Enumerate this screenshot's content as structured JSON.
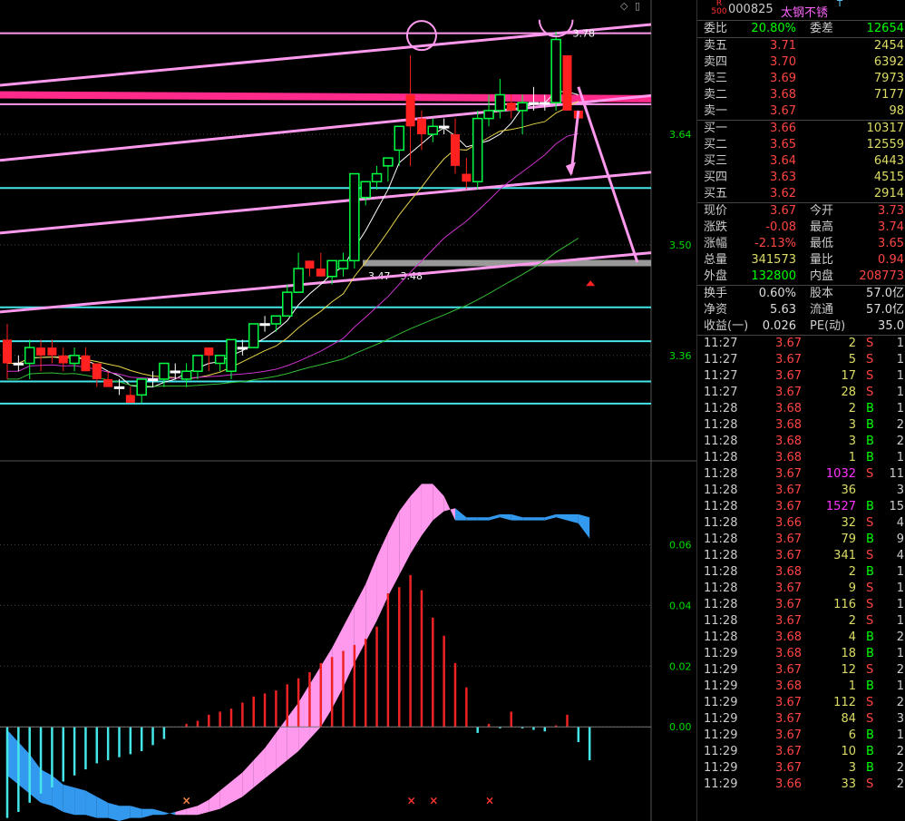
{
  "chart_data": [
    {
      "type": "candlestick",
      "title": "",
      "y_ticks": [
        "3.64",
        "3.50",
        "3.36"
      ],
      "y_tick_values": [
        3.64,
        3.5,
        3.36
      ],
      "ylim": [
        3.23,
        3.81
      ],
      "annotations": {
        "high_label": "3.78",
        "range_label": "3.47 - 3.48"
      },
      "candles": [
        {
          "o": 3.38,
          "h": 3.4,
          "l": 3.33,
          "c": 3.35
        },
        {
          "o": 3.35,
          "h": 3.36,
          "l": 3.34,
          "c": 3.35
        },
        {
          "o": 3.35,
          "h": 3.38,
          "l": 3.33,
          "c": 3.37
        },
        {
          "o": 3.37,
          "h": 3.38,
          "l": 3.34,
          "c": 3.36
        },
        {
          "o": 3.37,
          "h": 3.38,
          "l": 3.35,
          "c": 3.36
        },
        {
          "o": 3.36,
          "h": 3.37,
          "l": 3.34,
          "c": 3.35
        },
        {
          "o": 3.35,
          "h": 3.37,
          "l": 3.34,
          "c": 3.36
        },
        {
          "o": 3.36,
          "h": 3.37,
          "l": 3.34,
          "c": 3.34
        },
        {
          "o": 3.35,
          "h": 3.35,
          "l": 3.32,
          "c": 3.33
        },
        {
          "o": 3.33,
          "h": 3.34,
          "l": 3.32,
          "c": 3.32
        },
        {
          "o": 3.32,
          "h": 3.33,
          "l": 3.31,
          "c": 3.32
        },
        {
          "o": 3.31,
          "h": 3.32,
          "l": 3.3,
          "c": 3.3
        },
        {
          "o": 3.31,
          "h": 3.33,
          "l": 3.3,
          "c": 3.33
        },
        {
          "o": 3.33,
          "h": 3.34,
          "l": 3.32,
          "c": 3.33
        },
        {
          "o": 3.33,
          "h": 3.35,
          "l": 3.32,
          "c": 3.35
        },
        {
          "o": 3.34,
          "h": 3.35,
          "l": 3.33,
          "c": 3.34
        },
        {
          "o": 3.33,
          "h": 3.35,
          "l": 3.32,
          "c": 3.34
        },
        {
          "o": 3.34,
          "h": 3.36,
          "l": 3.33,
          "c": 3.36
        },
        {
          "o": 3.37,
          "h": 3.37,
          "l": 3.34,
          "c": 3.36
        },
        {
          "o": 3.35,
          "h": 3.36,
          "l": 3.34,
          "c": 3.36
        },
        {
          "o": 3.34,
          "h": 3.38,
          "l": 3.33,
          "c": 3.38
        },
        {
          "o": 3.37,
          "h": 3.38,
          "l": 3.36,
          "c": 3.37
        },
        {
          "o": 3.37,
          "h": 3.4,
          "l": 3.37,
          "c": 3.4
        },
        {
          "o": 3.4,
          "h": 3.41,
          "l": 3.39,
          "c": 3.4
        },
        {
          "o": 3.4,
          "h": 3.41,
          "l": 3.39,
          "c": 3.41
        },
        {
          "o": 3.41,
          "h": 3.45,
          "l": 3.41,
          "c": 3.44
        },
        {
          "o": 3.44,
          "h": 3.49,
          "l": 3.44,
          "c": 3.47
        },
        {
          "o": 3.48,
          "h": 3.48,
          "l": 3.46,
          "c": 3.47
        },
        {
          "o": 3.47,
          "h": 3.49,
          "l": 3.46,
          "c": 3.46
        },
        {
          "o": 3.46,
          "h": 3.48,
          "l": 3.45,
          "c": 3.48
        },
        {
          "o": 3.47,
          "h": 3.49,
          "l": 3.46,
          "c": 3.48
        },
        {
          "o": 3.48,
          "h": 3.59,
          "l": 3.47,
          "c": 3.59
        },
        {
          "o": 3.56,
          "h": 3.58,
          "l": 3.55,
          "c": 3.58
        },
        {
          "o": 3.58,
          "h": 3.6,
          "l": 3.57,
          "c": 3.59
        },
        {
          "o": 3.6,
          "h": 3.61,
          "l": 3.58,
          "c": 3.61
        },
        {
          "o": 3.62,
          "h": 3.65,
          "l": 3.6,
          "c": 3.65
        },
        {
          "o": 3.69,
          "h": 3.74,
          "l": 3.6,
          "c": 3.65
        },
        {
          "o": 3.66,
          "h": 3.67,
          "l": 3.62,
          "c": 3.64
        },
        {
          "o": 3.64,
          "h": 3.66,
          "l": 3.63,
          "c": 3.65
        },
        {
          "o": 3.65,
          "h": 3.66,
          "l": 3.64,
          "c": 3.65
        },
        {
          "o": 3.64,
          "h": 3.66,
          "l": 3.59,
          "c": 3.6
        },
        {
          "o": 3.59,
          "h": 3.61,
          "l": 3.57,
          "c": 3.58
        },
        {
          "o": 3.58,
          "h": 3.67,
          "l": 3.57,
          "c": 3.66
        },
        {
          "o": 3.66,
          "h": 3.69,
          "l": 3.65,
          "c": 3.67
        },
        {
          "o": 3.67,
          "h": 3.71,
          "l": 3.66,
          "c": 3.69
        },
        {
          "o": 3.68,
          "h": 3.69,
          "l": 3.66,
          "c": 3.67
        },
        {
          "o": 3.67,
          "h": 3.69,
          "l": 3.64,
          "c": 3.68
        },
        {
          "o": 3.68,
          "h": 3.7,
          "l": 3.67,
          "c": 3.68
        },
        {
          "o": 3.68,
          "h": 3.69,
          "l": 3.67,
          "c": 3.68
        },
        {
          "o": 3.68,
          "h": 3.77,
          "l": 3.67,
          "c": 3.76
        },
        {
          "o": 3.74,
          "h": 3.74,
          "l": 3.67,
          "c": 3.67
        },
        {
          "o": 3.67,
          "h": 3.67,
          "l": 3.66,
          "c": 3.66
        }
      ]
    },
    {
      "type": "bar",
      "title": "",
      "y_ticks": [
        "0.06",
        "0.04",
        "0.02",
        "0.00"
      ],
      "y_tick_values": [
        0.06,
        0.04,
        0.02,
        0.0
      ],
      "ylim": [
        -0.031,
        0.087
      ],
      "values": [
        -0.03,
        -0.028,
        -0.025,
        -0.022,
        -0.02,
        -0.018,
        -0.016,
        -0.014,
        -0.012,
        -0.011,
        -0.01,
        -0.009,
        -0.008,
        -0.006,
        -0.004,
        0.0,
        0.001,
        0.002,
        0.004,
        0.005,
        0.006,
        0.008,
        0.01,
        0.011,
        0.012,
        0.014,
        0.016,
        0.018,
        0.021,
        0.023,
        0.025,
        0.027,
        0.029,
        0.033,
        0.044,
        0.046,
        0.05,
        0.045,
        0.036,
        0.03,
        0.021,
        0.013,
        -0.002,
        0.001,
        -0.0005,
        0.005,
        -0.0005,
        -0.001,
        -0.0015,
        0.0005,
        0.004,
        -0.005,
        -0.011
      ],
      "dif": [
        -0.016,
        -0.019,
        -0.022,
        -0.025,
        -0.026,
        -0.028,
        -0.029,
        -0.029,
        -0.03,
        -0.03,
        -0.031,
        -0.03,
        -0.03,
        -0.029,
        -0.029,
        -0.028,
        -0.027,
        -0.026,
        -0.024,
        -0.021,
        -0.018,
        -0.015,
        -0.011,
        -0.007,
        -0.002,
        0.003,
        0.008,
        0.014,
        0.02,
        0.026,
        0.033,
        0.04,
        0.047,
        0.056,
        0.064,
        0.071,
        0.076,
        0.08,
        0.08,
        0.076,
        0.068,
        0.068,
        0.068,
        0.068,
        0.069,
        0.068,
        0.068,
        0.068,
        0.068,
        0.069,
        0.068,
        0.067,
        0.062
      ],
      "dea": [
        -0.001,
        -0.005,
        -0.009,
        -0.014,
        -0.016,
        -0.019,
        -0.02,
        -0.021,
        -0.023,
        -0.025,
        -0.026,
        -0.026,
        -0.027,
        -0.027,
        -0.028,
        -0.029,
        -0.029,
        -0.029,
        -0.028,
        -0.027,
        -0.025,
        -0.023,
        -0.02,
        -0.017,
        -0.014,
        -0.011,
        -0.008,
        -0.004,
        0.0,
        0.006,
        0.013,
        0.021,
        0.028,
        0.035,
        0.043,
        0.05,
        0.057,
        0.063,
        0.068,
        0.071,
        0.072,
        0.069,
        0.069,
        0.069,
        0.07,
        0.07,
        0.069,
        0.069,
        0.069,
        0.07,
        0.07,
        0.07,
        0.069
      ],
      "x_marks": [
        36,
        38,
        43
      ]
    }
  ],
  "colors": {
    "up": "#ff2222",
    "down": "#00ff66",
    "cyan": "#44e6ea",
    "pink": "#ff99ee",
    "hotpink": "#ff2a8a",
    "blue": "#3399ee"
  },
  "quote": {
    "exchange_badge_top": "R",
    "exchange_badge_bottom": "500",
    "code": "000825",
    "name": "太钢不锈",
    "t_mark": "T",
    "weibi_label": "委比",
    "weibi_value": "20.80%",
    "weicha_label": "委差",
    "weicha_value": "12654",
    "asks": [
      {
        "label": "卖五",
        "price": "3.71",
        "vol": "2454"
      },
      {
        "label": "卖四",
        "price": "3.70",
        "vol": "6392"
      },
      {
        "label": "卖三",
        "price": "3.69",
        "vol": "7973"
      },
      {
        "label": "卖二",
        "price": "3.68",
        "vol": "7177"
      },
      {
        "label": "卖一",
        "price": "3.67",
        "vol": "98"
      }
    ],
    "bids": [
      {
        "label": "买一",
        "price": "3.66",
        "vol": "10317"
      },
      {
        "label": "买二",
        "price": "3.65",
        "vol": "12559"
      },
      {
        "label": "买三",
        "price": "3.64",
        "vol": "6443"
      },
      {
        "label": "买四",
        "price": "3.63",
        "vol": "4515"
      },
      {
        "label": "买五",
        "price": "3.62",
        "vol": "2914"
      }
    ],
    "stats1": [
      {
        "l1": "现价",
        "v1": "3.67",
        "c1": "red",
        "l2": "今开",
        "v2": "3.73",
        "c2": "red"
      },
      {
        "l1": "涨跌",
        "v1": "-0.08",
        "c1": "red",
        "l2": "最高",
        "v2": "3.74",
        "c2": "red"
      },
      {
        "l1": "涨幅",
        "v1": "-2.13%",
        "c1": "red",
        "l2": "最低",
        "v2": "3.65",
        "c2": "red"
      },
      {
        "l1": "总量",
        "v1": "341573",
        "c1": "yel",
        "l2": "量比",
        "v2": "0.94",
        "c2": "red"
      },
      {
        "l1": "外盘",
        "v1": "132800",
        "c1": "green",
        "l2": "内盘",
        "v2": "208773",
        "c2": "red"
      }
    ],
    "stats2": [
      {
        "l1": "换手",
        "v1": "0.60%",
        "l2": "股本",
        "v2": "57.0亿"
      },
      {
        "l1": "净资",
        "v1": "5.63",
        "l2": "流通",
        "v2": "57.0亿"
      },
      {
        "l1": "收益(一)",
        "v1": "0.026",
        "l2": "PE(动)",
        "v2": "35.0"
      }
    ],
    "ticks": [
      {
        "t": "11:27",
        "p": "3.67",
        "v": "2",
        "bs": "S",
        "n": "1",
        "vc": "yel"
      },
      {
        "t": "11:27",
        "p": "3.67",
        "v": "5",
        "bs": "S",
        "n": "1",
        "vc": "yel"
      },
      {
        "t": "11:27",
        "p": "3.67",
        "v": "17",
        "bs": "S",
        "n": "1",
        "vc": "yel"
      },
      {
        "t": "11:27",
        "p": "3.67",
        "v": "28",
        "bs": "S",
        "n": "1",
        "vc": "yel"
      },
      {
        "t": "11:28",
        "p": "3.68",
        "v": "2",
        "bs": "B",
        "n": "1",
        "vc": "yel"
      },
      {
        "t": "11:28",
        "p": "3.68",
        "v": "3",
        "bs": "B",
        "n": "2",
        "vc": "yel"
      },
      {
        "t": "11:28",
        "p": "3.68",
        "v": "3",
        "bs": "B",
        "n": "2",
        "vc": "yel"
      },
      {
        "t": "11:28",
        "p": "3.68",
        "v": "1",
        "bs": "B",
        "n": "1",
        "vc": "yel"
      },
      {
        "t": "11:28",
        "p": "3.67",
        "v": "1032",
        "bs": "S",
        "n": "11",
        "vc": "mag"
      },
      {
        "t": "11:28",
        "p": "3.67",
        "v": "36",
        "bs": "",
        "n": "3",
        "vc": "yel"
      },
      {
        "t": "11:28",
        "p": "3.67",
        "v": "1527",
        "bs": "B",
        "n": "15",
        "vc": "mag"
      },
      {
        "t": "11:28",
        "p": "3.66",
        "v": "32",
        "bs": "S",
        "n": "4",
        "vc": "yel"
      },
      {
        "t": "11:28",
        "p": "3.67",
        "v": "79",
        "bs": "B",
        "n": "9",
        "vc": "yel"
      },
      {
        "t": "11:28",
        "p": "3.67",
        "v": "341",
        "bs": "S",
        "n": "4",
        "vc": "yel"
      },
      {
        "t": "11:28",
        "p": "3.68",
        "v": "2",
        "bs": "B",
        "n": "1",
        "vc": "yel"
      },
      {
        "t": "11:28",
        "p": "3.67",
        "v": "9",
        "bs": "S",
        "n": "1",
        "vc": "yel"
      },
      {
        "t": "11:28",
        "p": "3.67",
        "v": "116",
        "bs": "S",
        "n": "1",
        "vc": "yel"
      },
      {
        "t": "11:28",
        "p": "3.67",
        "v": "2",
        "bs": "S",
        "n": "1",
        "vc": "yel"
      },
      {
        "t": "11:28",
        "p": "3.68",
        "v": "4",
        "bs": "B",
        "n": "2",
        "vc": "yel"
      },
      {
        "t": "11:29",
        "p": "3.68",
        "v": "18",
        "bs": "B",
        "n": "1",
        "vc": "yel"
      },
      {
        "t": "11:29",
        "p": "3.67",
        "v": "12",
        "bs": "S",
        "n": "2",
        "vc": "yel"
      },
      {
        "t": "11:29",
        "p": "3.68",
        "v": "1",
        "bs": "B",
        "n": "1",
        "vc": "yel"
      },
      {
        "t": "11:29",
        "p": "3.67",
        "v": "112",
        "bs": "S",
        "n": "2",
        "vc": "yel"
      },
      {
        "t": "11:29",
        "p": "3.67",
        "v": "84",
        "bs": "S",
        "n": "3",
        "vc": "yel"
      },
      {
        "t": "11:29",
        "p": "3.67",
        "v": "6",
        "bs": "B",
        "n": "1",
        "vc": "yel"
      },
      {
        "t": "11:29",
        "p": "3.67",
        "v": "10",
        "bs": "B",
        "n": "2",
        "vc": "yel"
      },
      {
        "t": "11:29",
        "p": "3.67",
        "v": "3",
        "bs": "B",
        "n": "2",
        "vc": "yel"
      },
      {
        "t": "11:29",
        "p": "3.66",
        "v": "33",
        "bs": "S",
        "n": "2",
        "vc": "yel"
      }
    ]
  }
}
